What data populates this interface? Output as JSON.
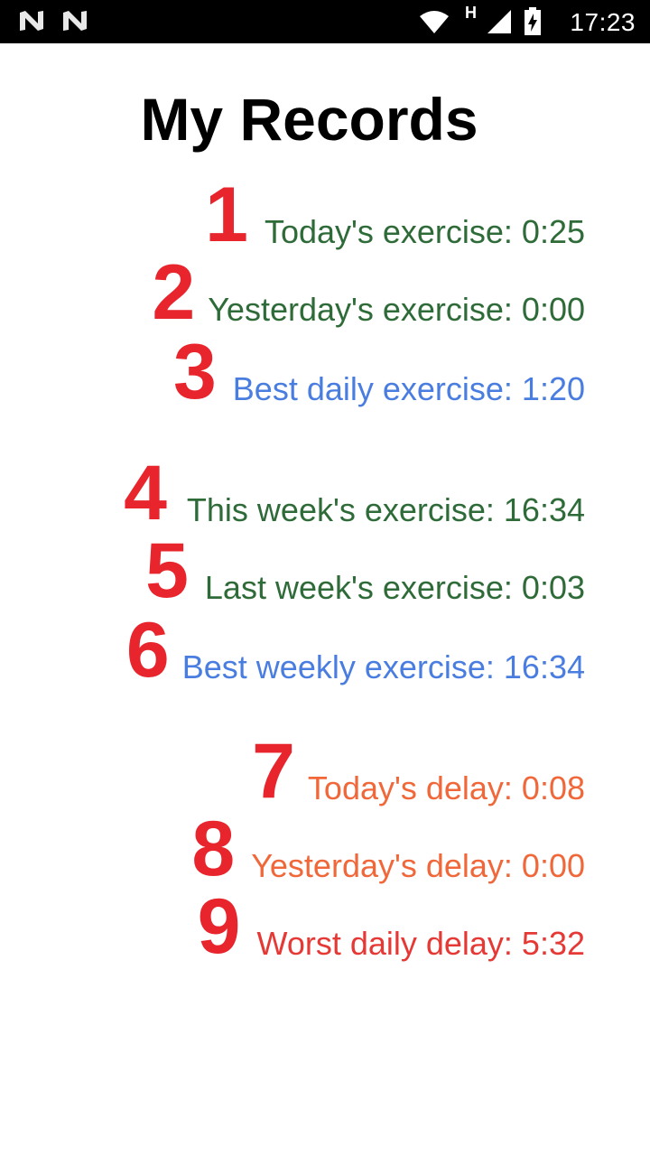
{
  "status_bar": {
    "left_icons": [
      "n-notification-icon",
      "n-notification-icon"
    ],
    "network_type": "H",
    "time": "17:23"
  },
  "title": "My Records",
  "records": [
    {
      "number": "1",
      "text": "Today's exercise: 0:25",
      "color": "#2e6b38"
    },
    {
      "number": "2",
      "text": "Yesterday's exercise: 0:00",
      "color": "#2e6b38"
    },
    {
      "number": "3",
      "text": "Best daily exercise: 1:20",
      "color": "#4a7de0"
    },
    {
      "number": "4",
      "text": "This week's exercise: 16:34",
      "color": "#2e6b38"
    },
    {
      "number": "5",
      "text": "Last week's exercise: 0:03",
      "color": "#2e6b38"
    },
    {
      "number": "6",
      "text": "Best weekly exercise: 16:34",
      "color": "#4a7de0"
    },
    {
      "number": "7",
      "text": "Today's delay: 0:08",
      "color": "#f0683a"
    },
    {
      "number": "8",
      "text": "Yesterday's delay: 0:00",
      "color": "#f0683a"
    },
    {
      "number": "9",
      "text": "Worst daily delay: 5:32",
      "color": "#e53935"
    }
  ],
  "number_color": "#e8242c"
}
